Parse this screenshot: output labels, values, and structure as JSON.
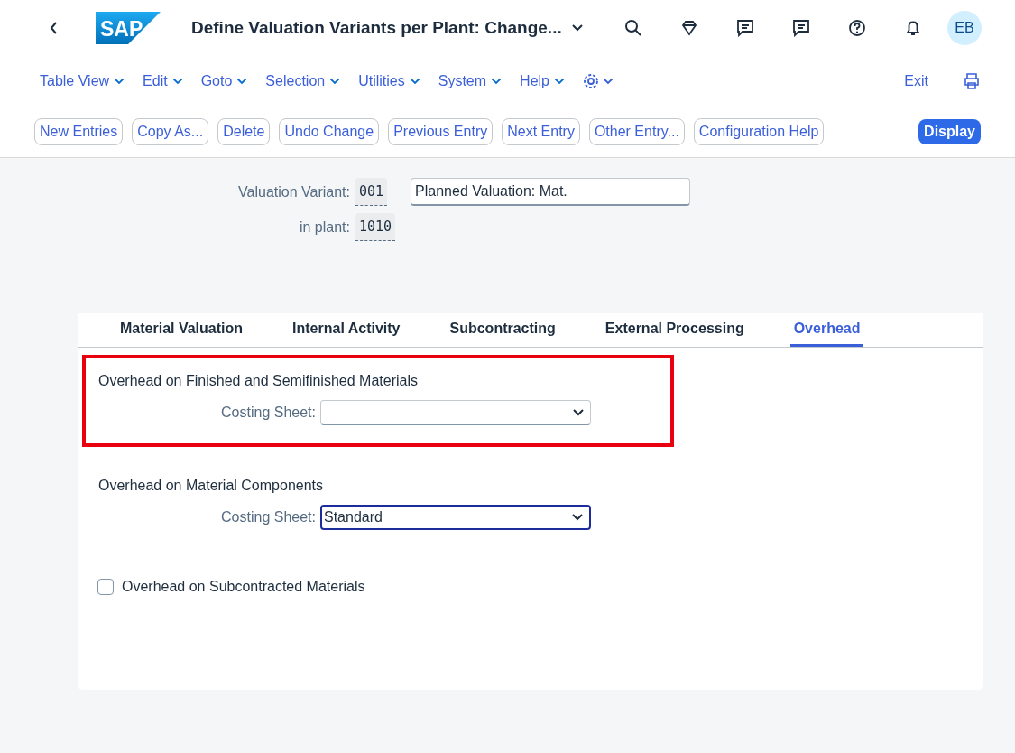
{
  "header": {
    "logo": "SAP",
    "title": "Define Valuation Variants per Plant: Change...",
    "avatar": "EB"
  },
  "menu": [
    {
      "label": "Table View",
      "kind": "text"
    },
    {
      "label": "Edit",
      "kind": "text"
    },
    {
      "label": "Goto",
      "kind": "text"
    },
    {
      "label": "Selection",
      "kind": "text"
    },
    {
      "label": "Utilities",
      "kind": "text"
    },
    {
      "label": "System",
      "kind": "text"
    },
    {
      "label": "Help",
      "kind": "text"
    },
    {
      "kind": "gear"
    }
  ],
  "exit": "Exit",
  "toolbar": [
    "New Entries",
    "Copy As...",
    "Delete",
    "Undo Change",
    "Previous Entry",
    "Next Entry",
    "Other Entry...",
    "Configuration Help"
  ],
  "display_button": "Display",
  "fields": [
    {
      "label": "Valuation Variant:",
      "value": "001",
      "description": "Planned Valuation: Mat."
    },
    {
      "label": "in plant:",
      "value": "1010"
    }
  ],
  "tabs": [
    {
      "label": "Material Valuation",
      "selected": false
    },
    {
      "label": "Internal Activity",
      "selected": false
    },
    {
      "label": "Subcontracting",
      "selected": false
    },
    {
      "label": "External Processing",
      "selected": false
    },
    {
      "label": "Overhead",
      "selected": true
    }
  ],
  "sections": [
    {
      "title": "Overhead on Finished and Semifinished Materials",
      "label": "Costing Sheet:",
      "highlighted": true,
      "focused": false
    },
    {
      "title": "Overhead on Material Components",
      "label": "Costing Sheet:",
      "value": "Standard",
      "highlighted": false,
      "focused": true
    }
  ],
  "checkbox": {
    "label": "Overhead on Subcontracted Materials",
    "checked": false
  }
}
